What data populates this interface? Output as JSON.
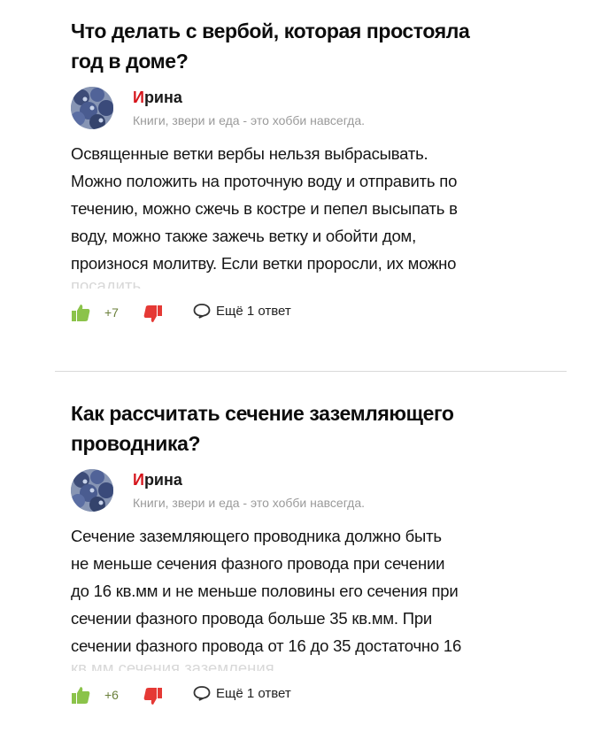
{
  "questions": [
    {
      "title_line1": "Что делать с вербой, которая простояла",
      "title_line2": "год в доме?",
      "author": {
        "first_letter": "И",
        "name_rest": "рина",
        "description": "Книги, звери и еда - это хобби навсегда."
      },
      "answer_lines": [
        "Освященные ветки вербы нельзя выбрасывать.",
        "Можно положить на проточную воду и отправить по",
        "течению, можно сжечь в костре и пепел высыпать в",
        "воду, можно также зажечь ветку и обойти дом,",
        "произнося молитву. Если ветки проросли, их можно"
      ],
      "answer_fade": "посадить",
      "likes": "+7",
      "more_answers": "Ещё 1 ответ"
    },
    {
      "title_line1": "Как рассчитать сечение заземляющего",
      "title_line2": "проводника?",
      "author": {
        "first_letter": "И",
        "name_rest": "рина",
        "description": "Книги, звери и еда - это хобби навсегда."
      },
      "answer_lines": [
        "Сечение заземляющего проводника должно быть",
        "не меньше сечения фазного провода при сечении",
        "до 16 кв.мм и не меньше половины его сечения при",
        "сечении фазного провода больше 35 кв.мм. При",
        "сечении фазного провода от 16 до 35 достаточно 16"
      ],
      "answer_fade": "кв.мм сечения заземления",
      "likes": "+6",
      "more_answers": "Ещё 1 ответ"
    }
  ],
  "icons": {
    "like": "thumb-up-icon",
    "dislike": "thumb-down-icon",
    "comment": "speech-bubble-icon",
    "avatar": "blueberries-avatar"
  },
  "colors": {
    "like": "#8bc34a",
    "dislike": "#e53935",
    "name_accent": "#d6161c"
  }
}
